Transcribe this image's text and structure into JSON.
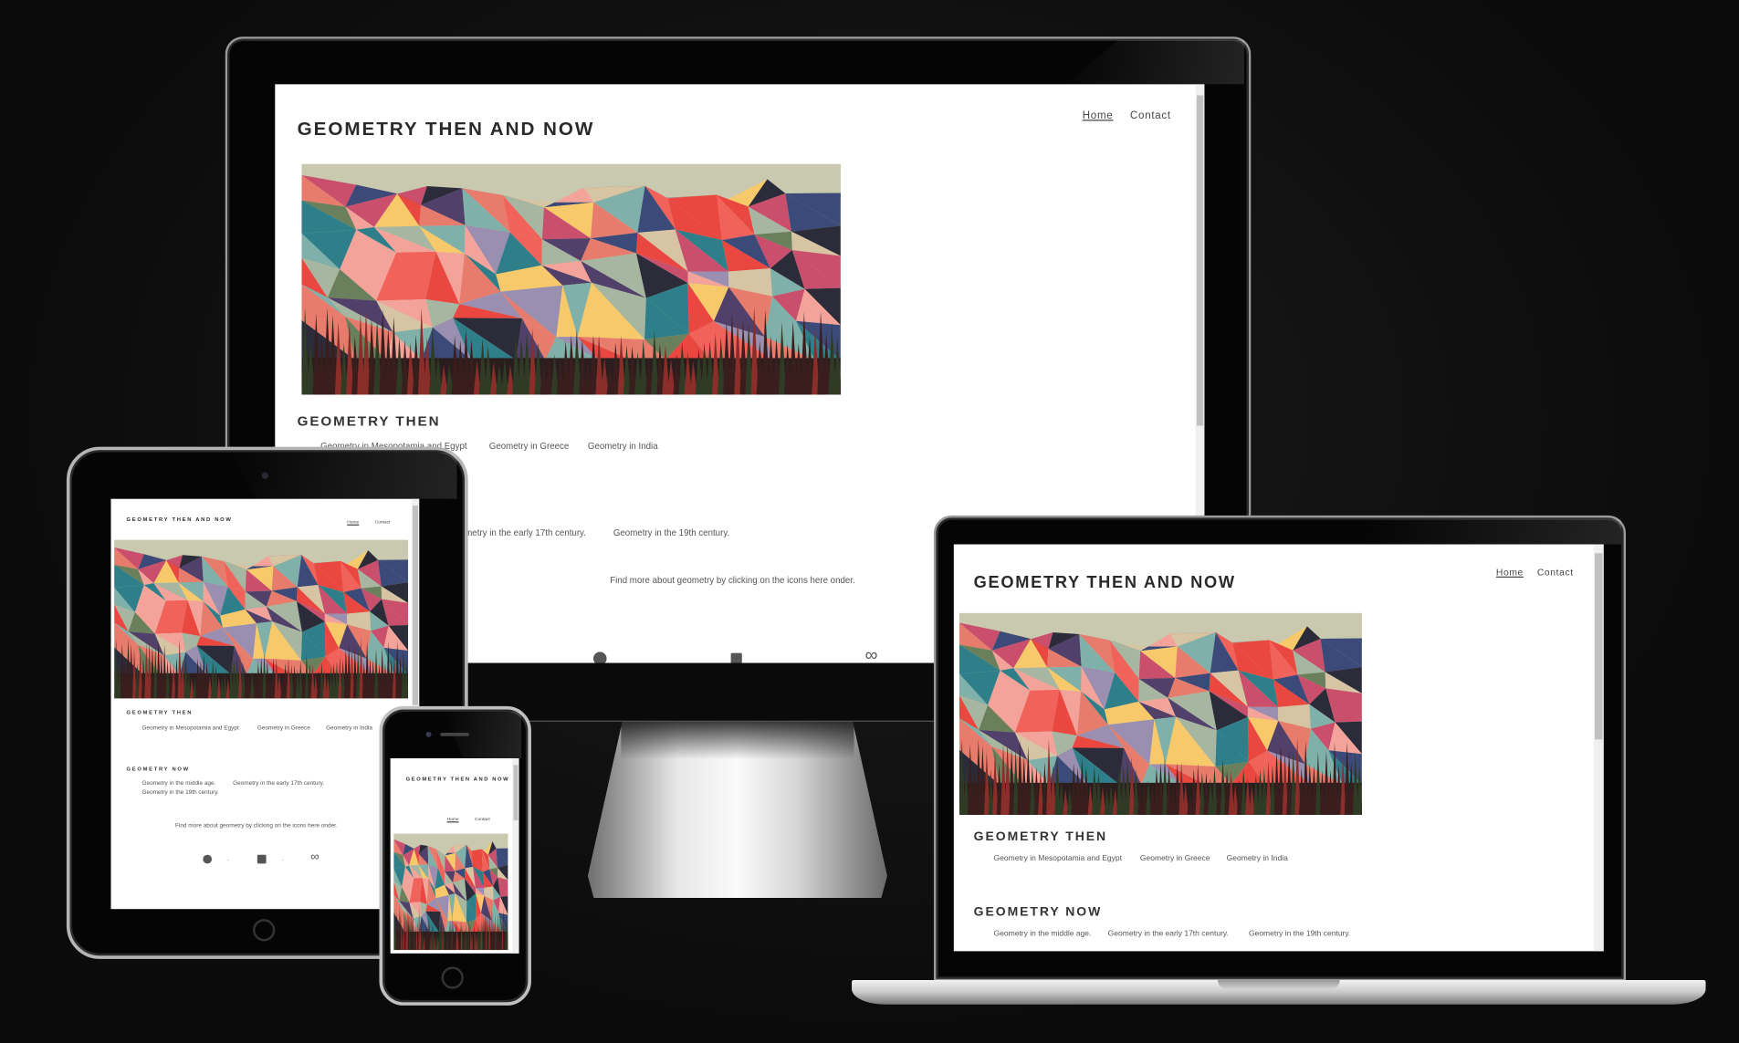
{
  "site": {
    "title": "GEOMETRY THEN AND NOW",
    "nav": {
      "home": "Home",
      "contact": "Contact"
    },
    "then": {
      "heading": "GEOMETRY THEN",
      "links": [
        "Geometry in Mesopotamia and Egypt",
        "Geometry in Greece",
        "Geometry in India"
      ]
    },
    "now": {
      "heading": "GEOMETRY NOW",
      "links": [
        "Geometry in the middle age.",
        "Geometry in the early 17th century.",
        "Geometry in the 19th century."
      ]
    },
    "footer_text": "Find more about geometry by clicking on the icons here onder.",
    "icons": [
      "circle-icon",
      "square-icon",
      "infinity-icon"
    ],
    "infinity_glyph": "∞",
    "separator": "."
  },
  "colors": {
    "background": "#0e0e0e",
    "screen": "#ffffff",
    "text": "#333333"
  }
}
